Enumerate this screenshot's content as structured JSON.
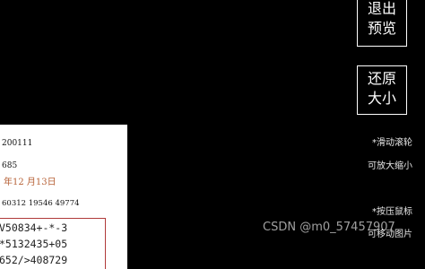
{
  "preview": {
    "document_lines": [
      "200111",
      "685",
      "年12 月13日",
      "60312 19546 49774"
    ],
    "code_lines": [
      "V50834+-*-3",
      "*5132435+05",
      "652/>408729"
    ]
  },
  "controls": {
    "exit_preview": {
      "line1": "退出",
      "line2": "预览"
    },
    "reset_size": {
      "line1": "还原",
      "line2": "大小"
    }
  },
  "hints": {
    "scroll_line1": "*滑动滚轮",
    "scroll_line2": "可放大缩小",
    "drag_line1": "*按压鼠标",
    "drag_line2": "可移动图片"
  },
  "watermark": "CSDN @m0_57457907"
}
